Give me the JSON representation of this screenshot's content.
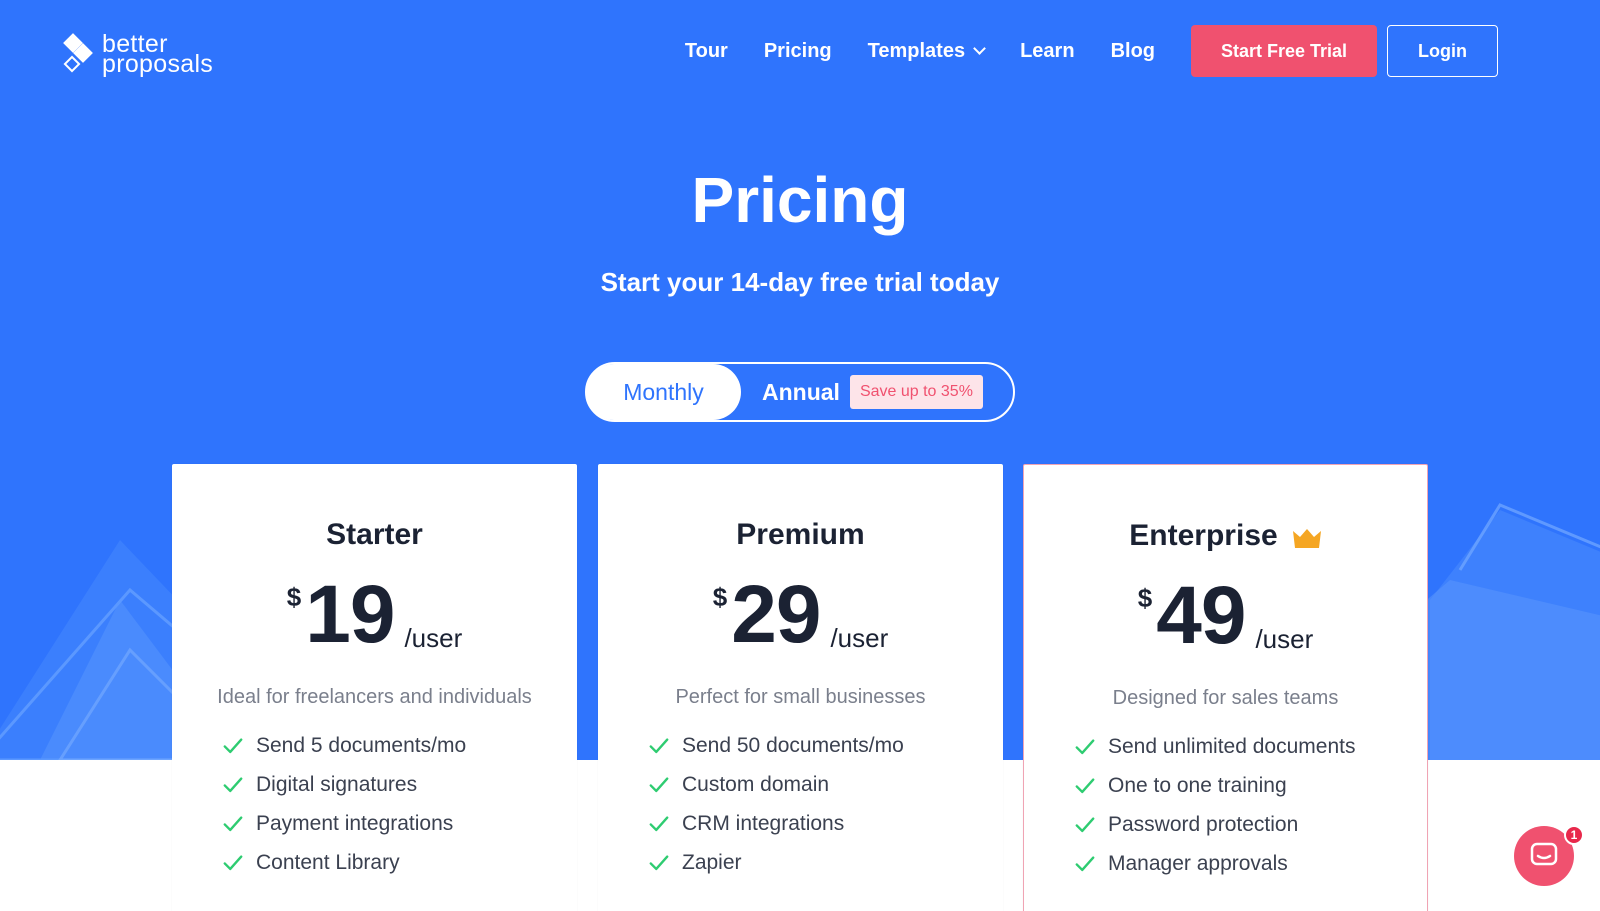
{
  "logo": {
    "line1": "better",
    "line2": "proposals"
  },
  "nav": {
    "items": [
      {
        "label": "Tour"
      },
      {
        "label": "Pricing"
      },
      {
        "label": "Templates"
      },
      {
        "label": "Learn"
      },
      {
        "label": "Blog"
      }
    ],
    "trial_button": "Start Free Trial",
    "login_button": "Login"
  },
  "hero": {
    "title": "Pricing",
    "subtitle": "Start your 14-day free trial today"
  },
  "billing_toggle": {
    "monthly": "Monthly",
    "annual": "Annual",
    "save_badge": "Save up to 35%",
    "selected": "Monthly"
  },
  "plans": [
    {
      "name": "Starter",
      "currency": "$",
      "price": "19",
      "per": "/user",
      "description": "Ideal for freelancers and individuals",
      "features": [
        "Send 5 documents/mo",
        "Digital signatures",
        "Payment integrations",
        "Content Library"
      ]
    },
    {
      "name": "Premium",
      "currency": "$",
      "price": "29",
      "per": "/user",
      "description": "Perfect for small businesses",
      "features": [
        "Send 50 documents/mo",
        "Custom domain",
        "CRM integrations",
        "Zapier"
      ]
    },
    {
      "name": "Enterprise",
      "currency": "$",
      "price": "49",
      "per": "/user",
      "description": "Designed for sales teams",
      "features": [
        "Send unlimited documents",
        "One to one training",
        "Password protection",
        "Manager approvals"
      ],
      "icon": "crown-icon"
    }
  ],
  "chat": {
    "unread_count": "1",
    "icon": "chat-bubble-icon"
  },
  "colors": {
    "hero_bg": "#2f74fd",
    "accent": "#f0516f",
    "check": "#2ecc71",
    "crown": "#f5a623"
  }
}
